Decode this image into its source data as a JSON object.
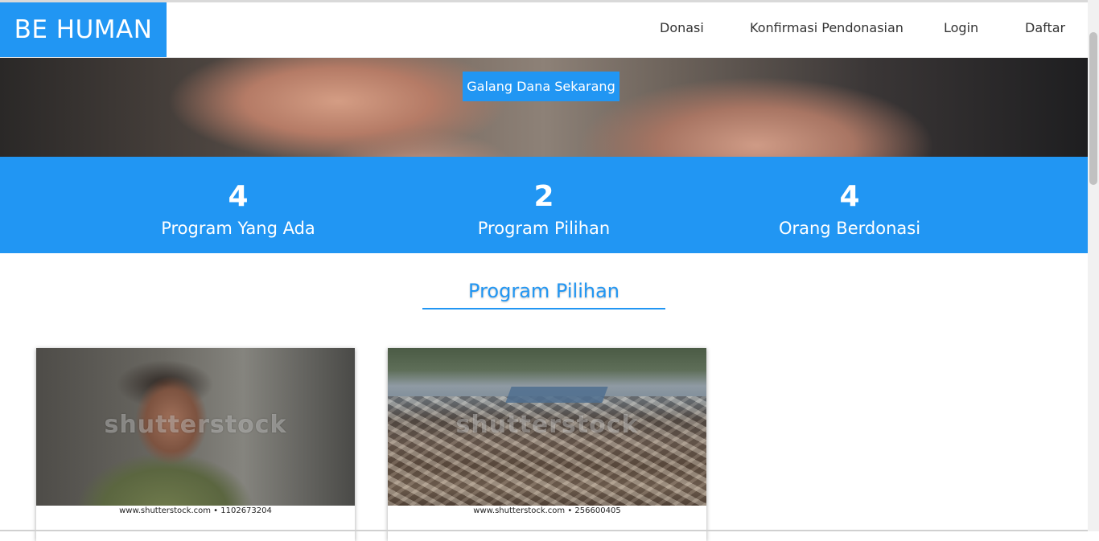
{
  "navbar": {
    "brand": "BE HUMAN",
    "links": [
      {
        "label": "Donasi"
      },
      {
        "label": "Konfirmasi Pendonasian"
      },
      {
        "label": "Login"
      },
      {
        "label": "Daftar"
      }
    ]
  },
  "hero": {
    "cta_label": "Galang Dana Sekarang"
  },
  "stats": [
    {
      "value": "4",
      "label": "Program Yang Ada"
    },
    {
      "value": "2",
      "label": "Program Pilihan"
    },
    {
      "value": "4",
      "label": "Orang Berdonasi"
    }
  ],
  "section": {
    "title": "Program Pilihan"
  },
  "cards": [
    {
      "watermark": "shutterstock",
      "caption": "www.shutterstock.com • 1102673204"
    },
    {
      "watermark": "shutterstock",
      "caption": "www.shutterstock.com • 256600405"
    }
  ],
  "colors": {
    "primary": "#2196f3",
    "background": "#ffffff"
  }
}
